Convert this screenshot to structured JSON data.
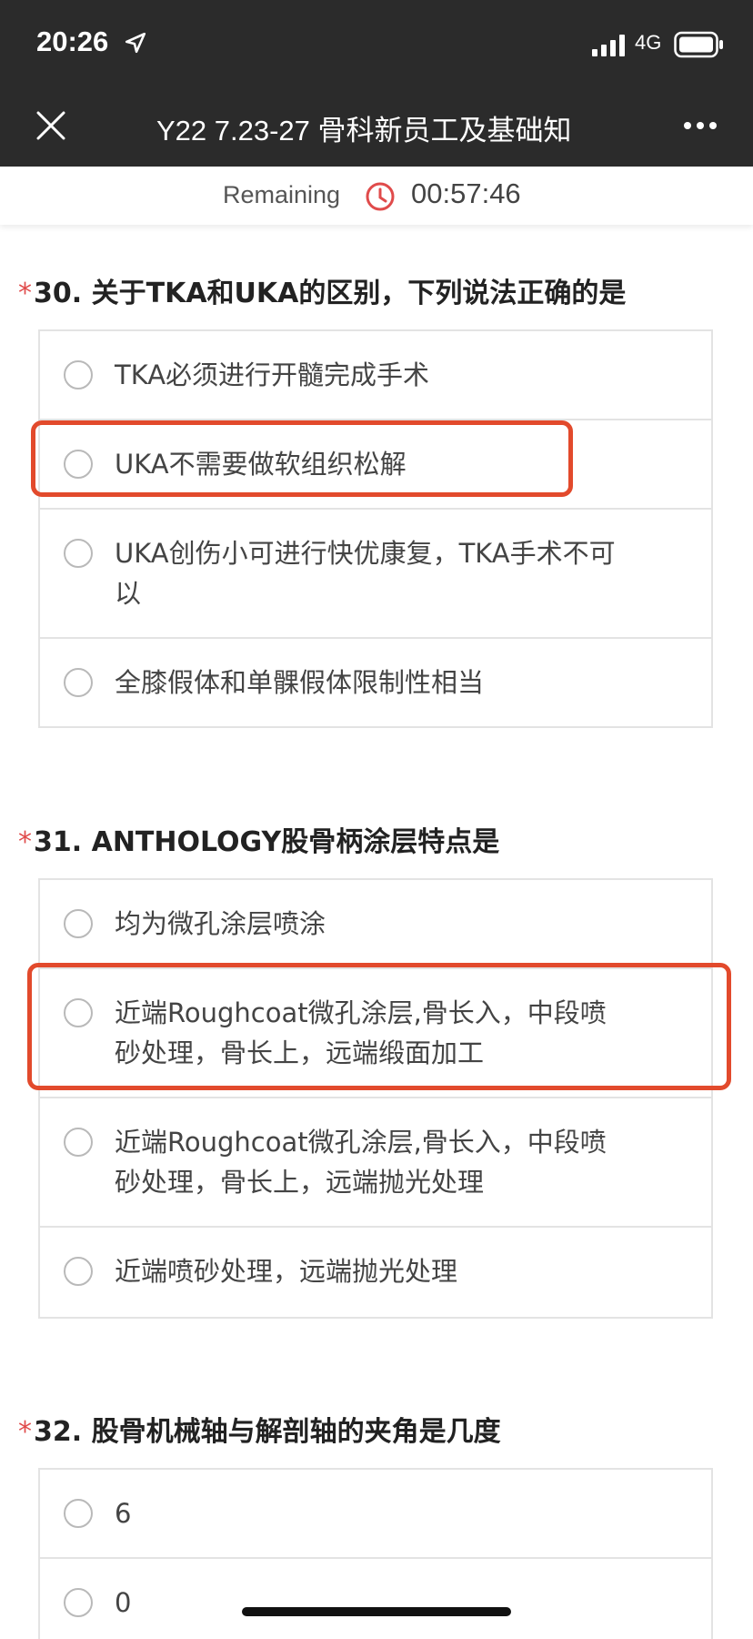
{
  "status_bar": {
    "time": "20:26",
    "network": "4G",
    "icons": [
      "location-arrow-icon",
      "signal-icon",
      "battery-icon"
    ]
  },
  "nav": {
    "title": "Y22 7.23-27 骨科新员工及基础知",
    "icons": [
      "close-icon",
      "more-icon"
    ]
  },
  "timer": {
    "label": "Remaining",
    "value": "00:57:46",
    "icon": "clock-icon",
    "accent": "#e04b4b"
  },
  "colors": {
    "topbar": "#2b2b2b",
    "required_star": "#e04b4b",
    "highlight_box": "#e24a2c"
  },
  "questions": [
    {
      "number": "30.",
      "required": "*",
      "title": "关于TKA和UKA的区别，下列说法正确的是",
      "options": [
        "TKA必须进行开髓完成手术",
        "UKA不需要做软组织松解",
        "UKA创伤小可进行快优康复，TKA手术不可以",
        "全膝假体和单髁假体限制性相当"
      ]
    },
    {
      "number": "31.",
      "required": "*",
      "title": "ANTHOLOGY股骨柄涂层特点是",
      "options": [
        "均为微孔涂层喷涂",
        "近端Roughcoat微孔涂层,骨长入，中段喷砂处理，骨长上，远端缎面加工",
        "近端Roughcoat微孔涂层,骨长入，中段喷砂处理，骨长上，远端抛光处理",
        "近端喷砂处理，远端抛光处理"
      ]
    },
    {
      "number": "32.",
      "required": "*",
      "title": "股骨机械轴与解剖轴的夹角是几度",
      "options": [
        "6",
        "0"
      ]
    }
  ]
}
